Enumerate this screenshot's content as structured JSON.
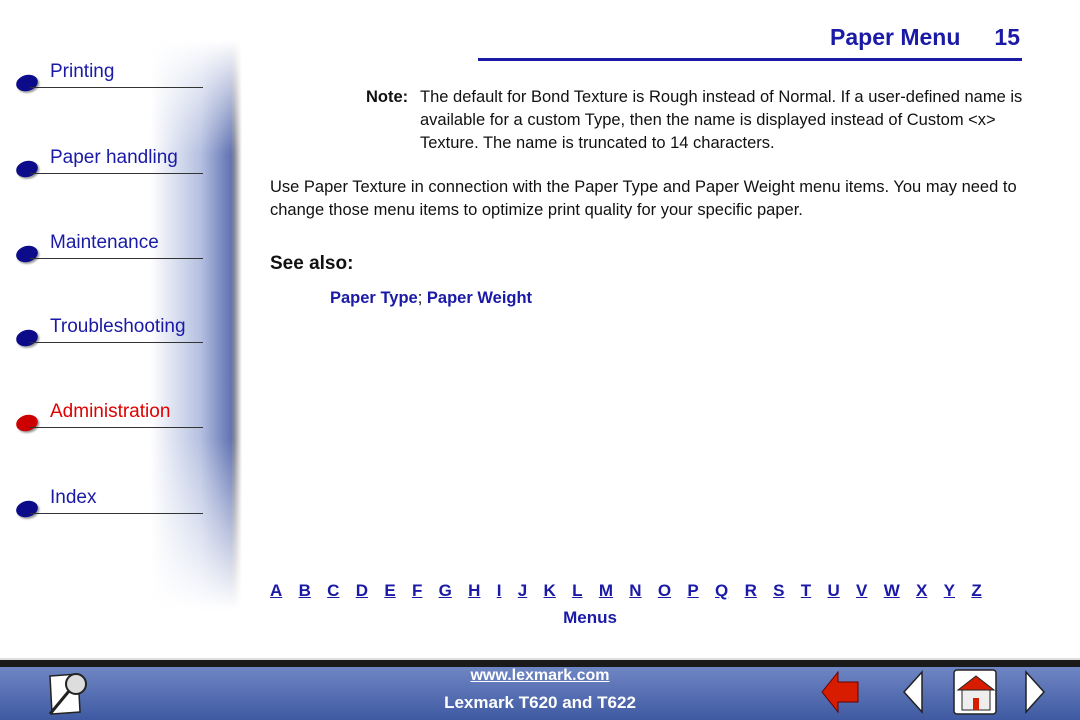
{
  "sidebar": {
    "items": [
      {
        "label": "Printing",
        "active": false
      },
      {
        "label": "Paper handling",
        "active": false
      },
      {
        "label": "Maintenance",
        "active": false
      },
      {
        "label": "Troubleshooting",
        "active": false
      },
      {
        "label": "Administration",
        "active": true
      },
      {
        "label": "Index",
        "active": false
      }
    ]
  },
  "header": {
    "title": "Paper Menu",
    "page": "15"
  },
  "content": {
    "note_label": "Note:",
    "note_text": "The default for Bond Texture is Rough instead of Normal. If a user-defined name is available for a custom Type, then the name is displayed instead of Custom <x> Texture. The name is truncated to 14 characters.",
    "paragraph": "Use Paper Texture in connection with the Paper Type and Paper Weight menu items. You may need to change those menu items to optimize print quality for your specific paper.",
    "see_also": "See also:",
    "links": [
      "Paper Type",
      "Paper Weight"
    ],
    "separator": ";"
  },
  "alphabet": [
    "A",
    "B",
    "C",
    "D",
    "E",
    "F",
    "G",
    "H",
    "I",
    "J",
    "K",
    "L",
    "M",
    "N",
    "O",
    "P",
    "Q",
    "R",
    "S",
    "T",
    "U",
    "V",
    "W",
    "X",
    "Y",
    "Z"
  ],
  "menus_link": "Menus",
  "footer": {
    "url": "www.lexmark.com",
    "model": "Lexmark T620 and T622",
    "icons": [
      "search-icon",
      "back-arrow-icon",
      "previous-page-icon",
      "home-icon",
      "next-page-icon"
    ]
  },
  "colors": {
    "link": "#1a1aa6",
    "active": "#e00000",
    "footer": "#4f68b0"
  }
}
